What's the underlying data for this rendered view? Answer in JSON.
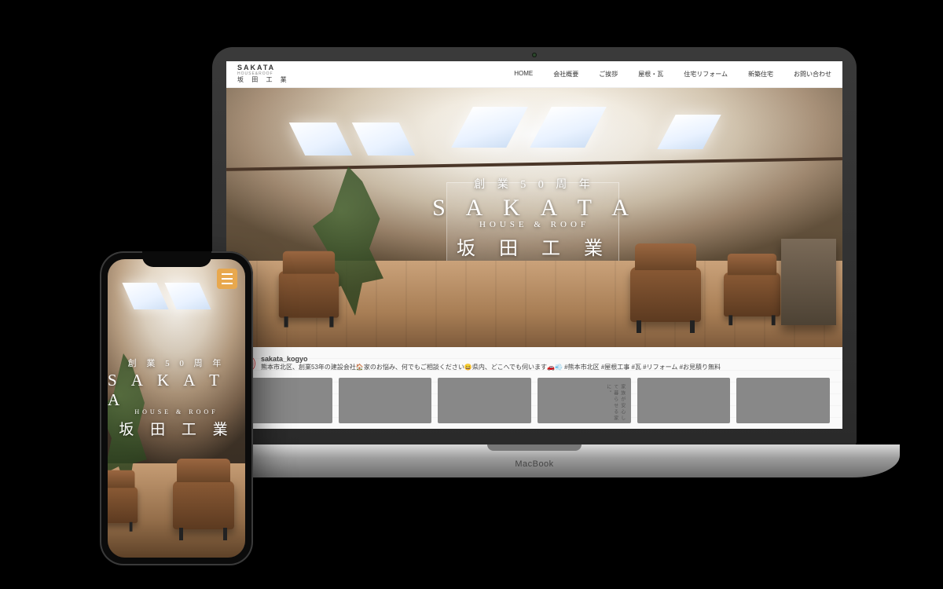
{
  "device": {
    "laptop_label": "MacBook"
  },
  "logo": {
    "line1": "SAKATA",
    "line2": "HOUSE&ROOF",
    "line3": "坂 田 工 業"
  },
  "nav": {
    "items": [
      "HOME",
      "会社概要",
      "ご挨拶",
      "屋根・瓦",
      "住宅リフォーム",
      "新築住宅",
      "お問い合わせ"
    ]
  },
  "hero": {
    "tagline": "創 業 5 0 周 年",
    "brand_en": "S A K A T A",
    "brand_sub": "HOUSE & ROOF",
    "brand_jp": "坂 田 工 業"
  },
  "social": {
    "handle": "sakata_kogyo",
    "bio": "熊本市北区、創業53年の建設会社🏠家のお悩み、何でもご相談ください😄県内、どこへでも伺います🚗💨 #熊本市北区 #屋根工事 #瓦 #リフォーム #お見積り無料",
    "thumb4_caption": "家族が安心して暮らせる家に。"
  }
}
